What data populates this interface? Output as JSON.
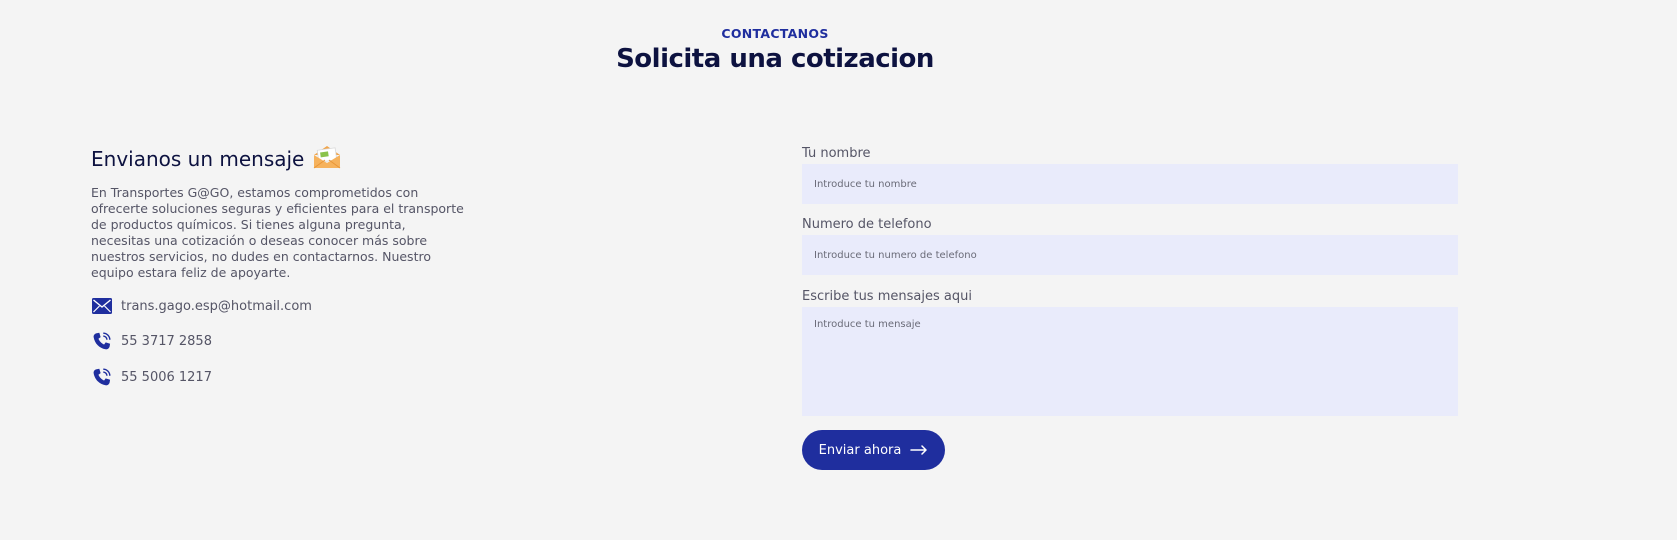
{
  "header": {
    "eyebrow": "CONTACTANOS",
    "title": "Solicita una cotizacion"
  },
  "info": {
    "heading": "Envianos un mensaje",
    "heading_icon": "envelope-open-icon",
    "description": "En Transportes G@GO, estamos comprometidos con ofrecerte soluciones seguras y eficientes para el transporte de productos químicos. Si tienes alguna pregunta, necesitas una cotización o deseas conocer más sobre nuestros servicios, no dudes en contactarnos. Nuestro equipo estara feliz de apoyarte.",
    "email": "trans.gago.esp@hotmail.com",
    "phones": [
      "55 3717 2858",
      "55 5006 1217"
    ]
  },
  "form": {
    "name_label": "Tu nombre",
    "name_placeholder": "Introduce tu nombre",
    "phone_label": "Numero de telefono",
    "phone_placeholder": "Introduce tu numero de telefono",
    "message_label": "Escribe tus mensajes aqui",
    "message_placeholder": "Introduce tu mensaje",
    "submit_label": "Enviar ahora"
  },
  "colors": {
    "accent": "#1f2e9e",
    "title": "#0d1240",
    "input_bg": "#e9ebfb",
    "page_bg": "#f4f4f4"
  }
}
